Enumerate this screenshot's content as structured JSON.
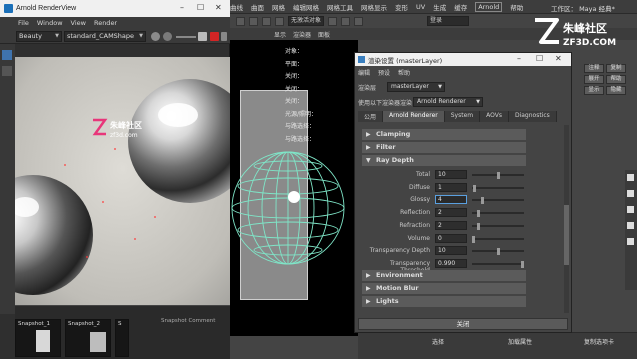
{
  "maya": {
    "menubar": [
      "曲线",
      "曲面",
      "网格",
      "编辑网格",
      "网格工具",
      "网格显示",
      "变形",
      "UV",
      "生成",
      "缓存",
      "Arnold",
      "帮助"
    ],
    "workspace_label": "工作区：",
    "workspace_value": "Maya 经典*",
    "object_field": "无激活对象",
    "login_field": "登录",
    "panel_tabs": [
      "显示",
      "渲染器",
      "面板"
    ],
    "viewport_info": [
      "对象：",
      "平面：",
      "关闭：",
      "关闭：",
      "关闭：",
      "光源/照明：",
      "与路选择：",
      "与路选择："
    ],
    "ae_buttons": [
      "注释",
      "展开",
      "显示",
      "复制",
      "帮助",
      "隐藏"
    ],
    "bottom_buttons": [
      "选择",
      "加载属性",
      "复制选项卡"
    ]
  },
  "renderview": {
    "title": "Arnold RenderView",
    "menu": [
      "File",
      "Window",
      "View",
      "Render"
    ],
    "aov": "Beauty",
    "camera": "standard_CAMShape",
    "snapshots": [
      "Snapshot_1",
      "Snapshot_2",
      "S"
    ],
    "snapshot_comment_label": "Snapshot Comment",
    "watermark_cn": "朱峰社区",
    "watermark_url": "zf3d.com"
  },
  "render_settings": {
    "title": "渲染设置 (masterLayer)",
    "menu": [
      "编辑",
      "预设",
      "帮助"
    ],
    "render_layer_label": "渲染层",
    "render_layer_value": "masterLayer",
    "renderer_label": "使用以下渲染器渲染",
    "renderer_value": "Arnold Renderer",
    "tabs": [
      "公用",
      "Arnold Renderer",
      "System",
      "AOVs",
      "Diagnostics"
    ],
    "active_tab": 1,
    "sections_top": [
      "Clamping",
      "Filter"
    ],
    "ray_depth": {
      "title": "Ray Depth",
      "rows": [
        {
          "label": "Total",
          "value": "10",
          "level": 0.52
        },
        {
          "label": "Diffuse",
          "value": "1",
          "level": 0.02
        },
        {
          "label": "Glossy",
          "value": "4",
          "level": 0.18
        },
        {
          "label": "Reflection",
          "value": "2",
          "level": 0.1
        },
        {
          "label": "Refraction",
          "value": "2",
          "level": 0.1
        },
        {
          "label": "Volume",
          "value": "0",
          "level": 0.0
        },
        {
          "label": "Transparency Depth",
          "value": "10",
          "level": 0.52
        },
        {
          "label": "Transparency Threshold",
          "value": "0.990",
          "level": 0.99
        }
      ]
    },
    "sections_bottom": [
      "Environment",
      "Motion Blur",
      "Lights"
    ],
    "close_button": "关闭"
  },
  "watermark_top": {
    "cn": "朱峰社区",
    "url": "ZF3D.COM"
  },
  "colors": {
    "accent_blue": "#4aa3ff",
    "mint_wire": "#7fe6c8"
  }
}
